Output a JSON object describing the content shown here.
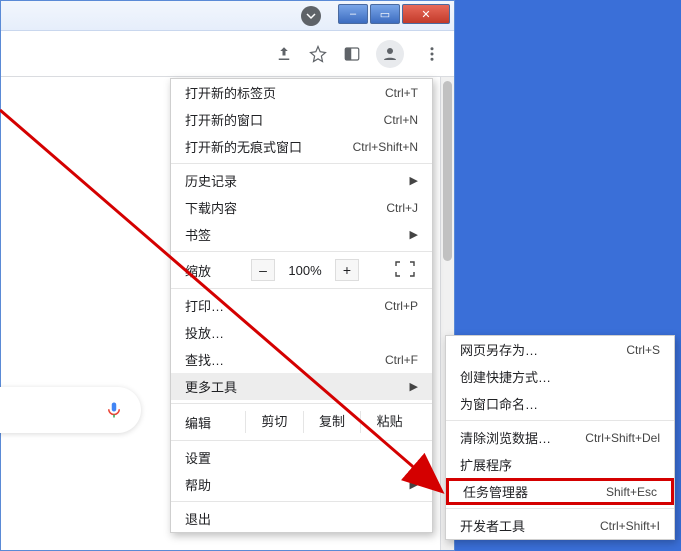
{
  "toolbar": {
    "share_icon": "share-icon",
    "star_icon": "star-icon",
    "panel_icon": "side-panel-icon",
    "profile_icon": "person-icon",
    "more_icon": "more-vertical-icon",
    "dropdown_icon": "chevron-down-icon",
    "mic_icon": "mic-icon"
  },
  "winbtns": {
    "min": "–",
    "max": "▭",
    "close": "✕"
  },
  "menu": {
    "new_tab": "打开新的标签页",
    "new_tab_sc": "Ctrl+T",
    "new_window": "打开新的窗口",
    "new_window_sc": "Ctrl+N",
    "incognito": "打开新的无痕式窗口",
    "incognito_sc": "Ctrl+Shift+N",
    "history": "历史记录",
    "downloads": "下载内容",
    "downloads_sc": "Ctrl+J",
    "bookmarks": "书签",
    "zoom_label": "缩放",
    "zoom_minus": "–",
    "zoom_value": "100%",
    "zoom_plus": "+",
    "print": "打印…",
    "print_sc": "Ctrl+P",
    "cast": "投放…",
    "find": "查找…",
    "find_sc": "Ctrl+F",
    "more_tools": "更多工具",
    "edit_label": "编辑",
    "cut": "剪切",
    "copy": "复制",
    "paste": "粘贴",
    "settings": "设置",
    "help": "帮助",
    "exit": "退出"
  },
  "submenu": {
    "save_as": "网页另存为…",
    "save_as_sc": "Ctrl+S",
    "create_shortcut": "创建快捷方式…",
    "name_window": "为窗口命名…",
    "clear_data": "清除浏览数据…",
    "clear_data_sc": "Ctrl+Shift+Del",
    "extensions": "扩展程序",
    "task_manager": "任务管理器",
    "task_manager_sc": "Shift+Esc",
    "dev_tools": "开发者工具",
    "dev_tools_sc": "Ctrl+Shift+I"
  }
}
